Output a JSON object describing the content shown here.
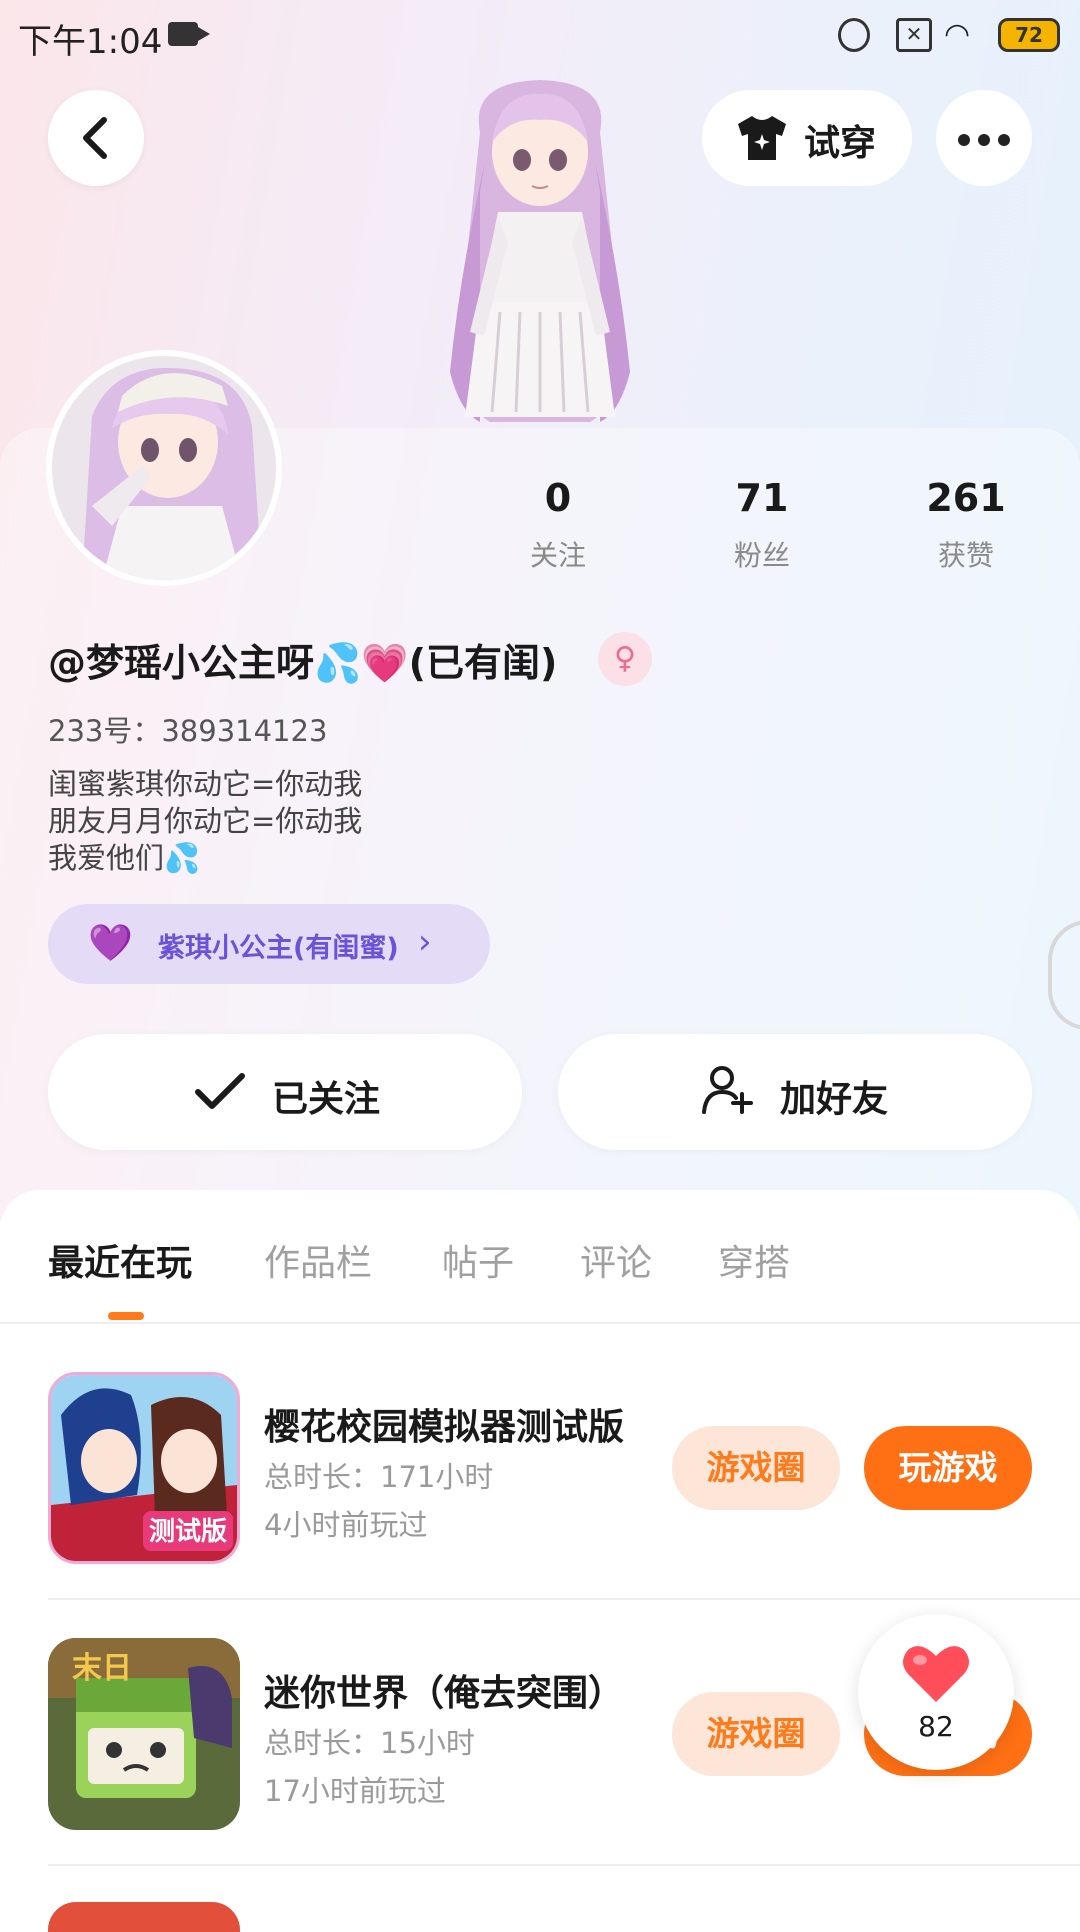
{
  "status_bar": {
    "time": "下午1:04",
    "battery": "72"
  },
  "header": {
    "try_on_label": "试穿"
  },
  "stats": [
    {
      "value": "0",
      "label": "关注"
    },
    {
      "value": "71",
      "label": "粉丝"
    },
    {
      "value": "261",
      "label": "获赞"
    }
  ],
  "profile": {
    "username": "@梦瑶小公主呀💦💗(已有闺)",
    "uid": "233号：389314123",
    "bio": [
      "闺蜜紫琪你动它=你动我",
      "朋友月月你动它=你动我",
      "我爱他们💦"
    ],
    "bestie_label": "紫琪小公主(有闺蜜)",
    "follow_label": "已关注",
    "add_friend_label": "加好友"
  },
  "tabs": [
    {
      "label": "最近在玩",
      "active": true
    },
    {
      "label": "作品栏",
      "active": false
    },
    {
      "label": "帖子",
      "active": false
    },
    {
      "label": "评论",
      "active": false
    },
    {
      "label": "穿搭",
      "active": false
    }
  ],
  "games": [
    {
      "title": "樱花校园模拟器测试版",
      "duration": "总时长：171小时",
      "last_played": "4小时前玩过",
      "circle_label": "游戏圈",
      "play_label": "玩游戏",
      "icon_badge": "测试版"
    },
    {
      "title": "迷你世界（俺去突围）",
      "duration": "总时长：15小时",
      "last_played": "17小时前玩过",
      "circle_label": "游戏圈",
      "play_label": "玩游戏",
      "icon_badge": "末日"
    }
  ],
  "like_fab": {
    "count": "82"
  },
  "colors": {
    "accent": "#ff7014",
    "accent_soft": "#fde6d8",
    "bestie": "#6b52d8",
    "bestie_bg": "#e4dbf6"
  }
}
